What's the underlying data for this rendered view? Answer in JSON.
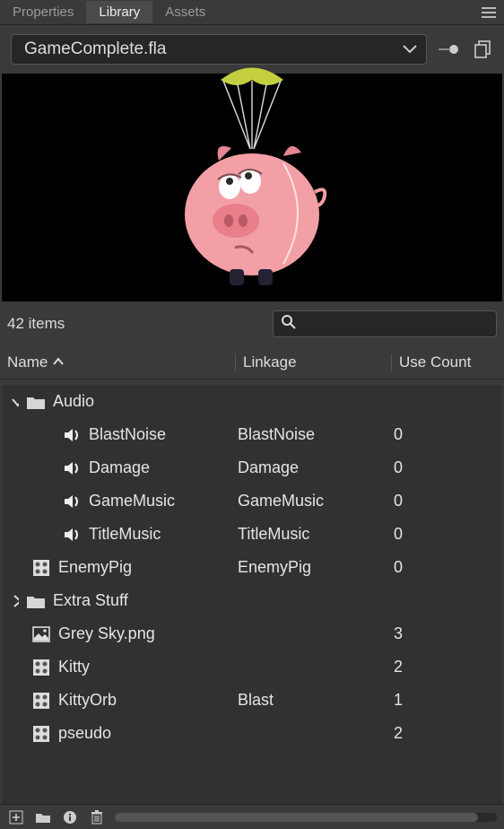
{
  "tabs": {
    "properties": "Properties",
    "library": "Library",
    "assets": "Assets"
  },
  "document": {
    "name": "GameComplete.fla"
  },
  "count_label": "42 items",
  "search": {
    "placeholder": ""
  },
  "columns": {
    "name": "Name",
    "linkage": "Linkage",
    "use": "Use Count"
  },
  "items": [
    {
      "type": "folder",
      "name": "Audio",
      "expanded": true,
      "linkage": "",
      "use": ""
    },
    {
      "type": "sound",
      "name": "BlastNoise",
      "linkage": "BlastNoise",
      "use": "0",
      "child": true
    },
    {
      "type": "sound",
      "name": "Damage",
      "linkage": "Damage",
      "use": "0",
      "child": true
    },
    {
      "type": "sound",
      "name": "GameMusic",
      "linkage": "GameMusic",
      "use": "0",
      "child": true
    },
    {
      "type": "sound",
      "name": "TitleMusic",
      "linkage": "TitleMusic",
      "use": "0",
      "child": true
    },
    {
      "type": "movieclip",
      "name": "EnemyPig",
      "linkage": "EnemyPig",
      "use": "0"
    },
    {
      "type": "folder",
      "name": "Extra Stuff",
      "expanded": false,
      "linkage": "",
      "use": ""
    },
    {
      "type": "bitmap",
      "name": "Grey Sky.png",
      "linkage": "",
      "use": "3"
    },
    {
      "type": "movieclip",
      "name": "Kitty",
      "linkage": "",
      "use": "2"
    },
    {
      "type": "movieclip",
      "name": "KittyOrb",
      "linkage": "Blast",
      "use": "1"
    },
    {
      "type": "movieclip",
      "name": "pseudo",
      "linkage": "",
      "use": "2"
    }
  ]
}
